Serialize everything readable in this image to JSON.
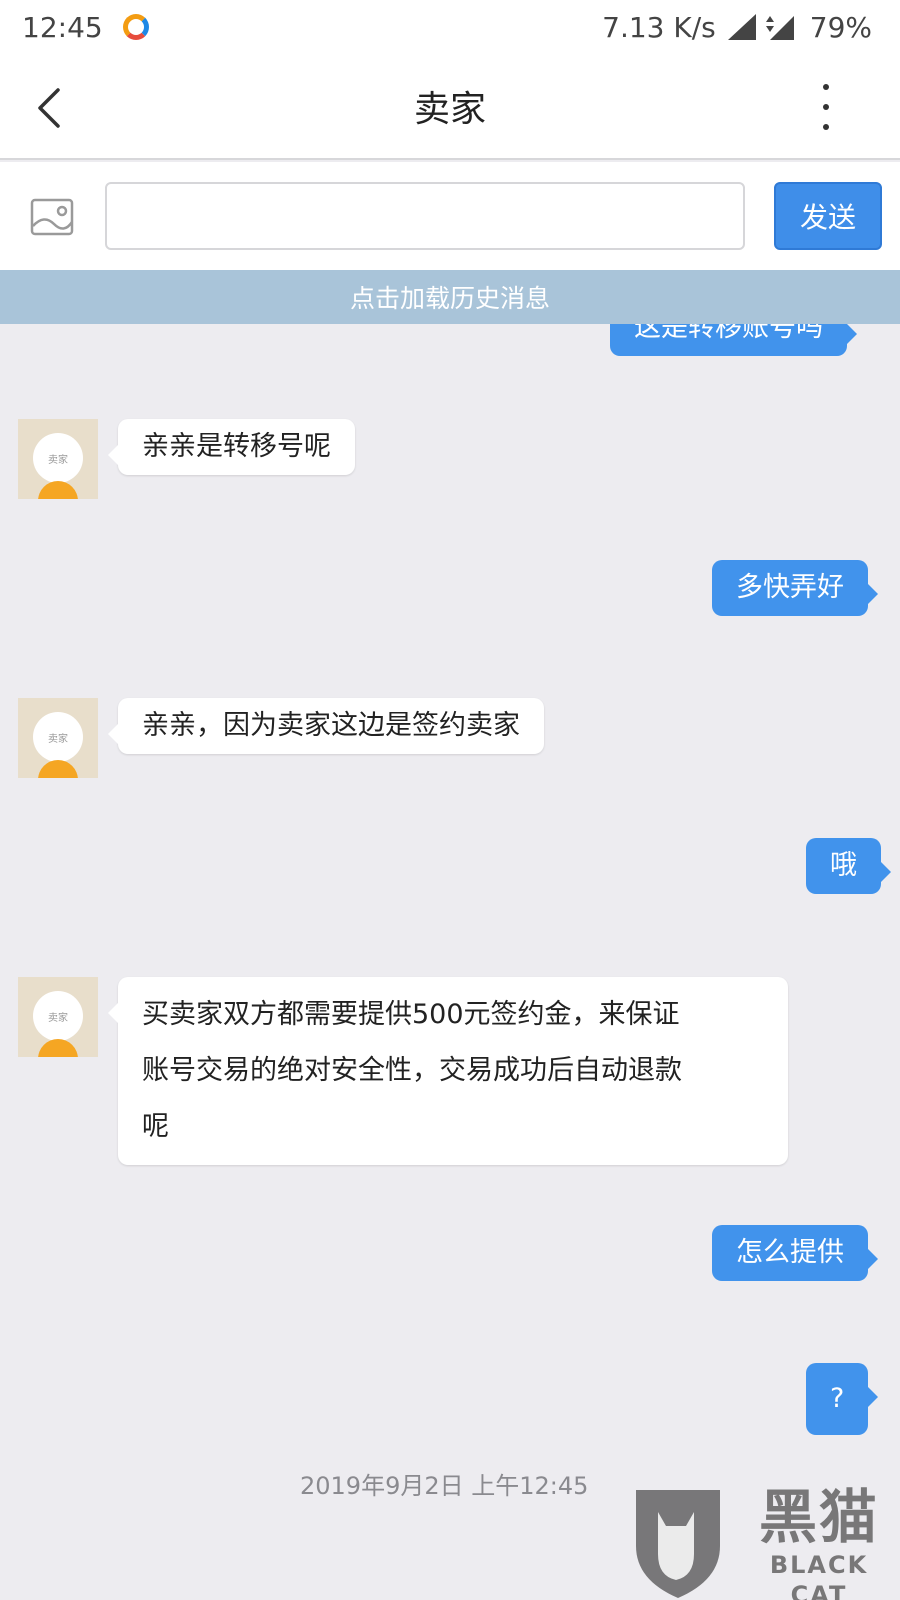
{
  "status_bar": {
    "time": "12:45",
    "speed": "7.13 K/s",
    "network": "4G",
    "battery": "79%"
  },
  "header": {
    "title": "卖家",
    "back_icon": "chevron-left-icon",
    "more_icon": "more-vertical-icon"
  },
  "composer": {
    "image_icon": "image-icon",
    "input_value": "",
    "send_label": "发送"
  },
  "history_bar": {
    "label": "点击加载历史消息"
  },
  "messages": [
    {
      "from": "me",
      "text": "这是转移账号吗"
    },
    {
      "from": "seller",
      "text": "亲亲是转移号呢"
    },
    {
      "from": "me",
      "text": "多快弄好"
    },
    {
      "from": "seller",
      "text": "亲亲，因为卖家这边是签约卖家"
    },
    {
      "from": "me",
      "text": "哦"
    },
    {
      "from": "seller",
      "lines": [
        "买卖家双方都需要提供500元签约金，来保证",
        "账号交易的绝对安全性，交易成功后自动退款",
        "呢"
      ]
    },
    {
      "from": "me",
      "text": "怎么提供"
    },
    {
      "from": "me",
      "text": "?"
    }
  ],
  "avatar_label": "卖家",
  "timestamp": "2019年9月2日 上午12:45",
  "watermark": {
    "cn": "黑猫",
    "en": "BLACK CAT"
  },
  "colors": {
    "accent": "#4193ec",
    "background": "#edecf0",
    "history_bar": "#a9c4d9",
    "avatar_bg": "#e8decb",
    "avatar_body": "#f5a623"
  }
}
